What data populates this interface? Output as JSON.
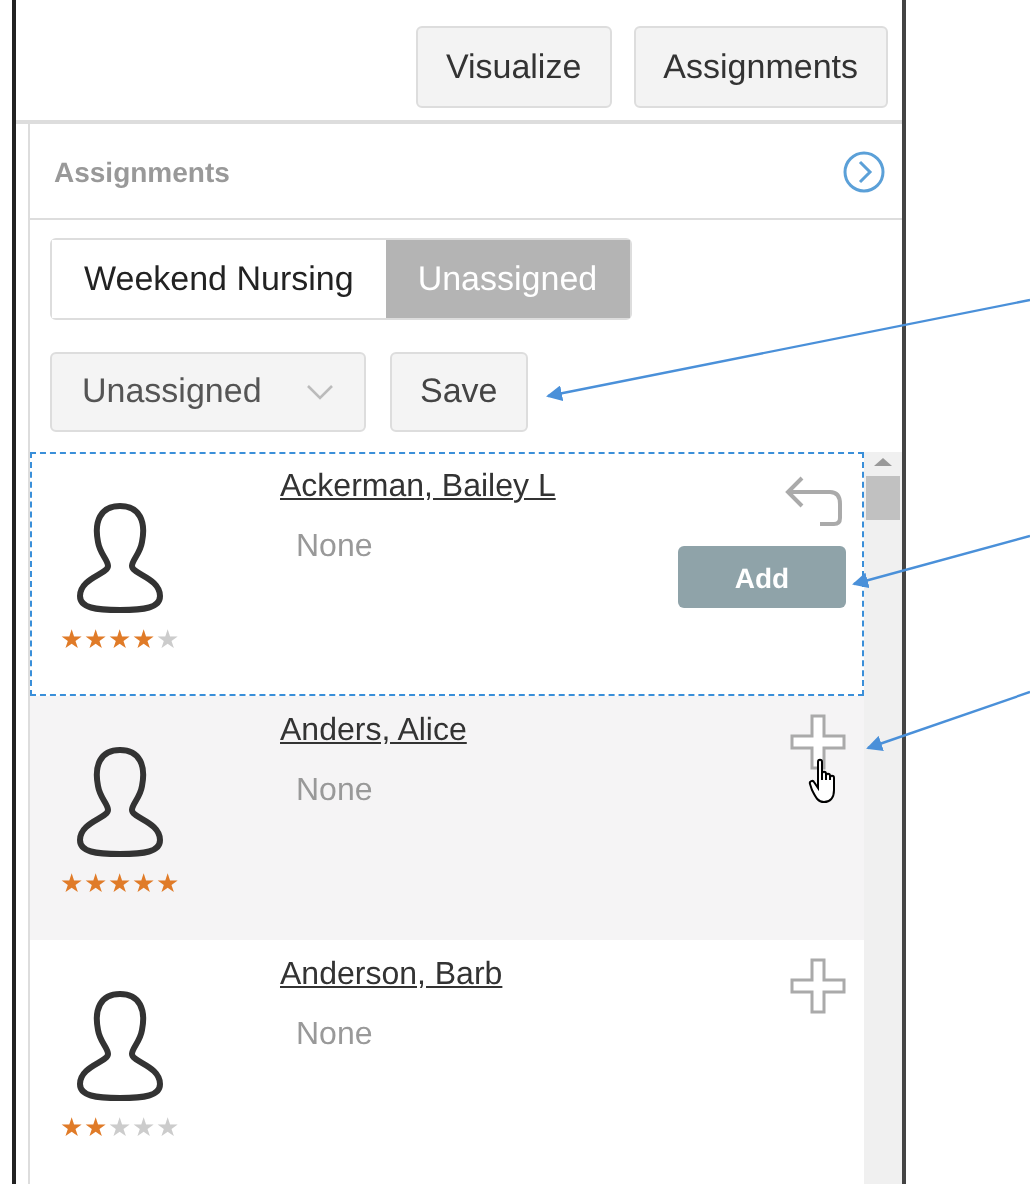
{
  "toolbar": {
    "buttons": [
      "Visualize",
      "Assignments"
    ]
  },
  "panel": {
    "title": "Assignments"
  },
  "tabs": [
    {
      "label": "Weekend Nursing",
      "selected": false
    },
    {
      "label": "Unassigned",
      "selected": true
    }
  ],
  "filter": {
    "value": "Unassigned"
  },
  "save_button": "Save",
  "people": [
    {
      "name": "Ackerman, Bailey L",
      "detail": "None",
      "stars": 4,
      "kind": "added",
      "focused": true,
      "highlighted": false,
      "action": "Add"
    },
    {
      "name": "Anders, Alice",
      "detail": "None",
      "stars": 5,
      "kind": "available",
      "focused": false,
      "highlighted": true
    },
    {
      "name": "Anderson, Barb",
      "detail": "None",
      "stars": 2,
      "kind": "available",
      "focused": false,
      "highlighted": false
    }
  ]
}
